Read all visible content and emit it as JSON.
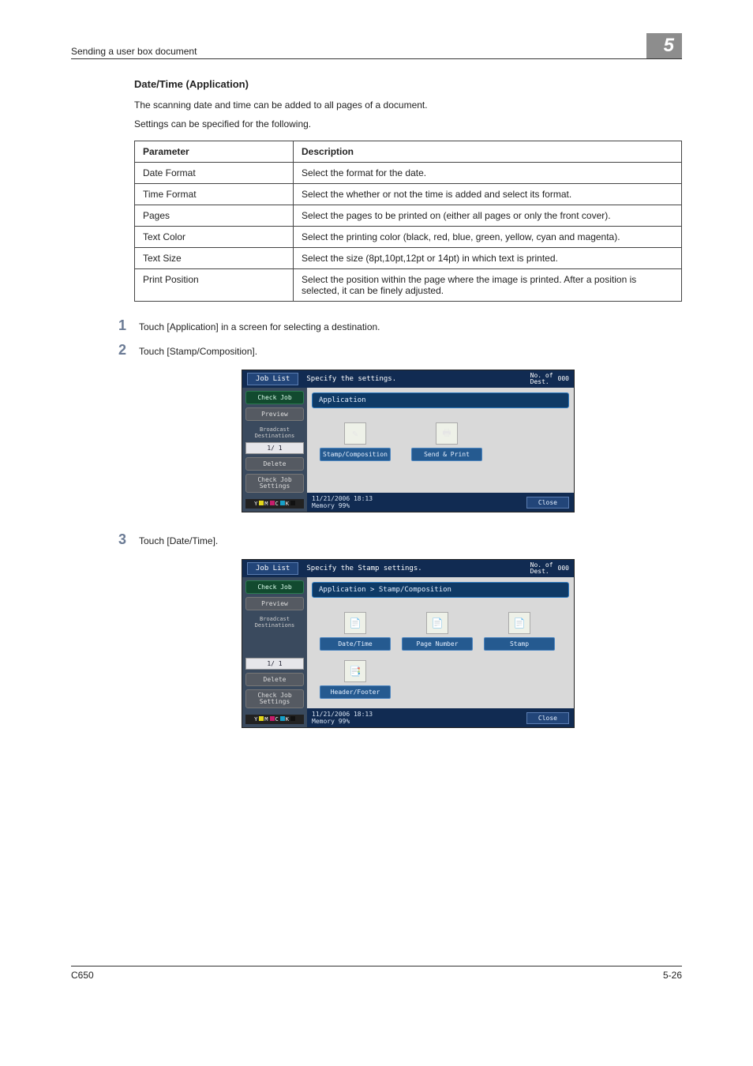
{
  "header": {
    "running_head": "Sending a user box document",
    "chapter_number": "5"
  },
  "section": {
    "title": "Date/Time (Application)",
    "intro1": "The scanning date and time can be added to all pages of a document.",
    "intro2": "Settings can be specified for the following."
  },
  "table": {
    "head_param": "Parameter",
    "head_desc": "Description",
    "rows": [
      {
        "p": "Date Format",
        "d": "Select the format for the date."
      },
      {
        "p": "Time Format",
        "d": "Select the whether or not the time is added and select its format."
      },
      {
        "p": "Pages",
        "d": "Select the pages to be printed on (either all pages or only the front cover)."
      },
      {
        "p": "Text Color",
        "d": "Select the printing color (black, red, blue, green, yellow, cyan and magenta)."
      },
      {
        "p": "Text Size",
        "d": "Select the size (8pt,10pt,12pt or 14pt) in which text is printed."
      },
      {
        "p": "Print Position",
        "d": "Select the position within the page where the image is printed. After a position is selected, it can be finely adjusted."
      }
    ]
  },
  "steps": {
    "s1_num": "1",
    "s1_text": "Touch [Application] in a screen for selecting a destination.",
    "s2_num": "2",
    "s2_text": "Touch [Stamp/Composition].",
    "s3_num": "3",
    "s3_text": "Touch [Date/Time]."
  },
  "screen_common": {
    "job_list": "Job List",
    "check_job": "Check Job",
    "preview": "Preview",
    "broadcast": "Broadcast\nDestinations",
    "page_ctr": "1/  1",
    "delete": "Delete",
    "check_job_settings": "Check Job\nSettings",
    "no_of_dest": "No. of\nDest.",
    "no_of_dest_val": "000",
    "close": "Close",
    "timestamp": "11/21/2006   18:13",
    "memory": "Memory        99%",
    "ymck": {
      "y": "Y",
      "m": "M",
      "c": "C",
      "k": "K"
    }
  },
  "screen_a": {
    "header_text": "Specify the settings.",
    "crumb": "Application",
    "tiles": [
      {
        "label": "Stamp/Composition",
        "icon": "✎"
      },
      {
        "label": "Send & Print",
        "icon": "🖶"
      }
    ]
  },
  "screen_b": {
    "header_text": "Specify the Stamp settings.",
    "crumb": "Application > Stamp/Composition",
    "tiles_row1": [
      {
        "label": "Date/Time",
        "icon": "📄"
      },
      {
        "label": "Page Number",
        "icon": "📄"
      },
      {
        "label": "Stamp",
        "icon": "📄"
      }
    ],
    "tiles_row2": [
      {
        "label": "Header/Footer",
        "icon": "📑"
      }
    ]
  },
  "footer": {
    "model": "C650",
    "page": "5-26"
  }
}
